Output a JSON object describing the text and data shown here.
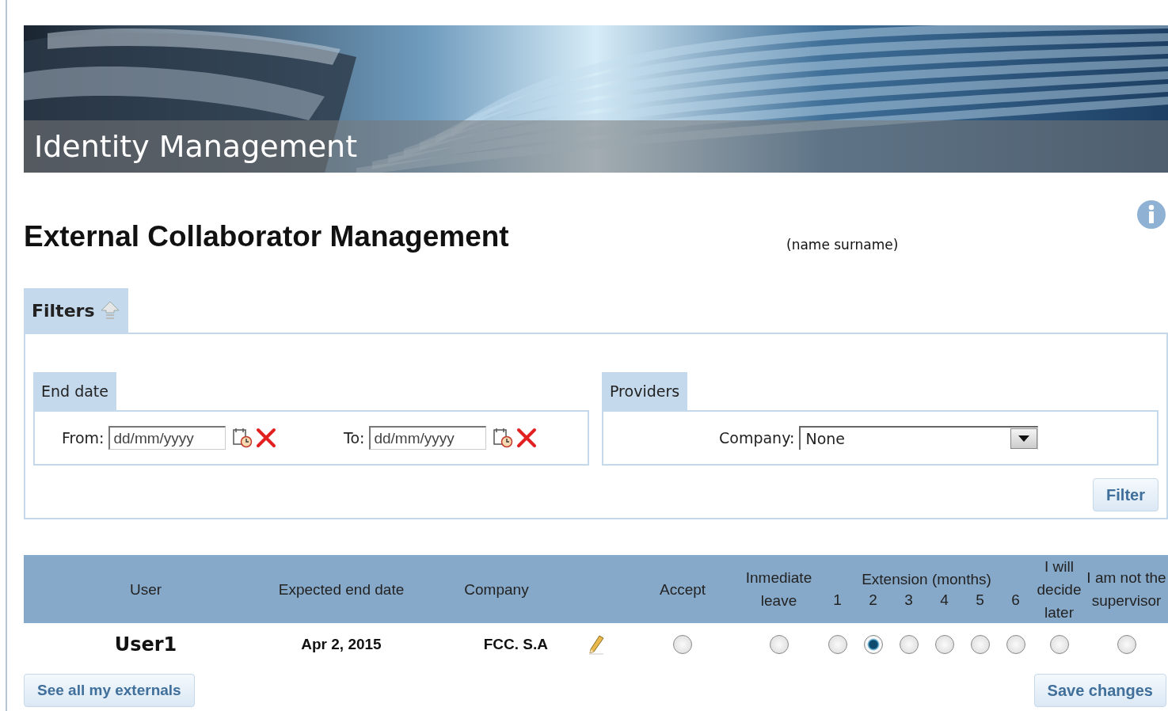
{
  "banner": {
    "title": "Identity Management"
  },
  "page": {
    "title": "External Collaborator Management",
    "user_name": "(name surname)"
  },
  "filters": {
    "label": "Filters",
    "end_date": {
      "label": "End date",
      "from": {
        "label": "From:",
        "placeholder": "dd/mm/yyyy"
      },
      "to": {
        "label": "To:",
        "placeholder": "dd/mm/yyyy"
      }
    },
    "providers": {
      "label": "Providers",
      "company": {
        "label": "Company:",
        "value": "None"
      }
    },
    "button": "Filter"
  },
  "table": {
    "columns": {
      "user": "User",
      "end_date": "Expected end date",
      "company": "Company",
      "accept": "Accept",
      "leave": "Inmediate leave",
      "extension": {
        "label": "Extension (months)",
        "months": [
          "1",
          "2",
          "3",
          "4",
          "5",
          "6"
        ]
      },
      "decide_later": "I will decide later",
      "not_supervisor": "I am not the supervisor"
    },
    "rows": [
      {
        "user": "User1",
        "end_date": "Apr 2, 2015",
        "company": "FCC. S.A",
        "choices": [
          {
            "selected": false
          },
          {
            "selected": false
          },
          {
            "selected": false
          },
          {
            "selected": true
          },
          {
            "selected": false
          },
          {
            "selected": false
          },
          {
            "selected": false
          },
          {
            "selected": false
          },
          {
            "selected": false
          },
          {
            "selected": false
          }
        ]
      }
    ]
  },
  "buttons": {
    "see_all": "See all my externals",
    "save": "Save changes"
  }
}
